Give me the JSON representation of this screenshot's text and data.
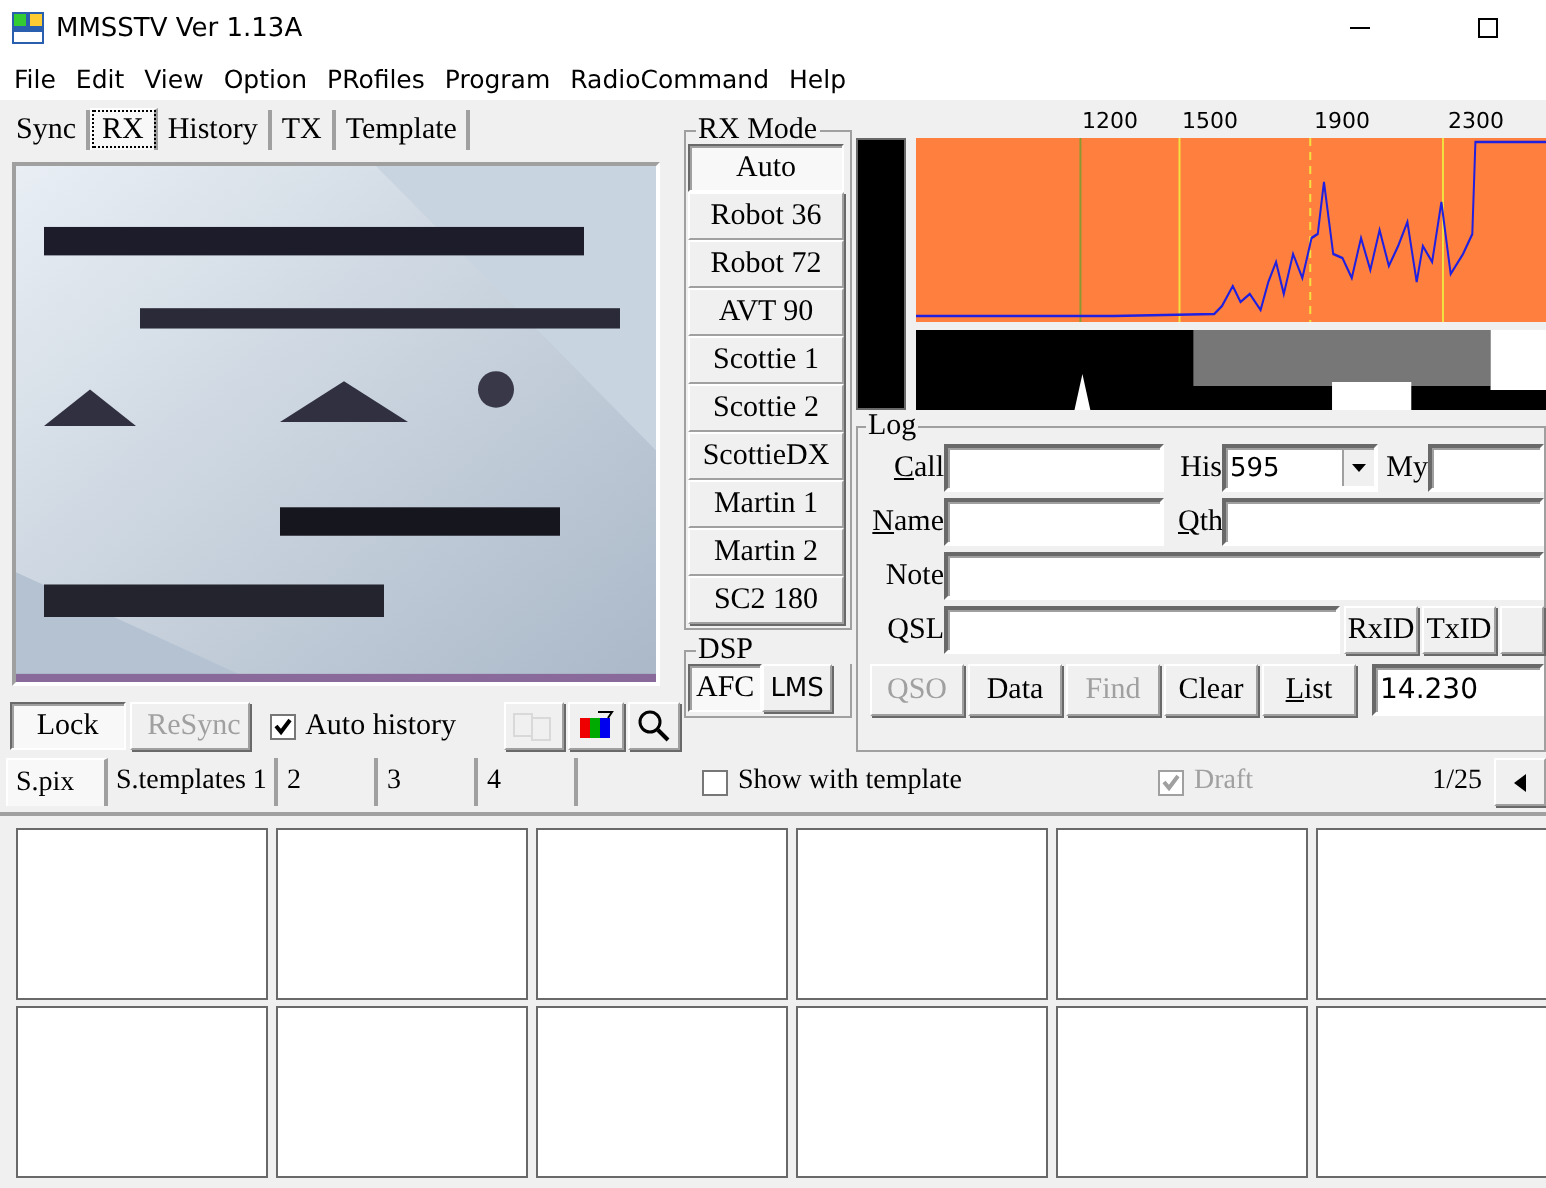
{
  "window": {
    "title": "MMSSTV Ver 1.13A"
  },
  "menu": [
    "File",
    "Edit",
    "View",
    "Option",
    "PRofiles",
    "Program",
    "RadioCommand",
    "Help"
  ],
  "main_tabs": [
    {
      "label": "Sync",
      "selected": false
    },
    {
      "label": "RX",
      "selected": true
    },
    {
      "label": "History",
      "selected": false
    },
    {
      "label": "TX",
      "selected": false
    },
    {
      "label": "Template",
      "selected": false
    }
  ],
  "rx_controls": {
    "buttons": [
      {
        "label": "Lock",
        "disabled": false
      },
      {
        "label": "ReSync",
        "disabled": true
      }
    ],
    "auto_history": {
      "label": "Auto history",
      "checked": true
    },
    "tools": [
      {
        "kind": "copy",
        "disabled": true
      },
      {
        "kind": "color",
        "disabled": false
      },
      {
        "kind": "zoom",
        "disabled": false
      }
    ]
  },
  "rx_mode": {
    "title": "RX Mode",
    "modes": [
      {
        "label": "Auto",
        "selected": true
      },
      {
        "label": "Robot 36",
        "selected": false
      },
      {
        "label": "Robot 72",
        "selected": false
      },
      {
        "label": "AVT 90",
        "selected": false
      },
      {
        "label": "Scottie 1",
        "selected": false
      },
      {
        "label": "Scottie 2",
        "selected": false
      },
      {
        "label": "ScottieDX",
        "selected": false
      },
      {
        "label": "Martin 1",
        "selected": false
      },
      {
        "label": "Martin 2",
        "selected": false
      },
      {
        "label": "SC2 180",
        "selected": false
      }
    ]
  },
  "dsp": {
    "title": "DSP",
    "buttons": [
      {
        "label": "AFC",
        "selected": true
      },
      {
        "label": "LMS",
        "selected": false
      }
    ]
  },
  "spectrum": {
    "ticks": [
      "1200",
      "1500",
      "1900",
      "2300"
    ]
  },
  "log": {
    "title": "Log",
    "call": {
      "label": "Call",
      "accelerator": true
    },
    "his": {
      "label": "His",
      "value": "595"
    },
    "my": {
      "label": "My"
    },
    "name": {
      "label": "Name",
      "accelerator": true
    },
    "qth": {
      "label": "Qth",
      "accelerator": true
    },
    "note": {
      "label": "Note"
    },
    "qsl": {
      "label": "QSL"
    },
    "id_buttons": [
      "RxID",
      "TxID"
    ],
    "actions": [
      {
        "label": "QSO",
        "disabled": true,
        "accelerator": false
      },
      {
        "label": "Data",
        "disabled": false,
        "accelerator": false
      },
      {
        "label": "Find",
        "disabled": true,
        "accelerator": false
      },
      {
        "label": "Clear",
        "disabled": false,
        "accelerator": false
      },
      {
        "label": "List",
        "disabled": false,
        "accelerator": true
      }
    ],
    "frequency": "14.230"
  },
  "lower_tabs": [
    {
      "label": "S.pix",
      "selected": true
    },
    {
      "label": "S.templates 1",
      "selected": false
    },
    {
      "label": "2",
      "selected": false
    },
    {
      "label": "3",
      "selected": false
    },
    {
      "label": "4",
      "selected": false
    }
  ],
  "show_with_template": {
    "label": "Show with template",
    "checked": false
  },
  "draft": {
    "label": "Draft",
    "checked": true,
    "disabled": true
  },
  "page": "1/25",
  "thumbnails": [
    {
      "filled": false
    },
    {
      "filled": false
    },
    {
      "filled": false
    },
    {
      "filled": false
    },
    {
      "filled": false
    },
    {
      "filled": false
    },
    {
      "filled": false
    },
    {
      "filled": false
    },
    {
      "filled": false
    },
    {
      "filled": false
    },
    {
      "filled": false
    },
    {
      "filled": false
    }
  ]
}
